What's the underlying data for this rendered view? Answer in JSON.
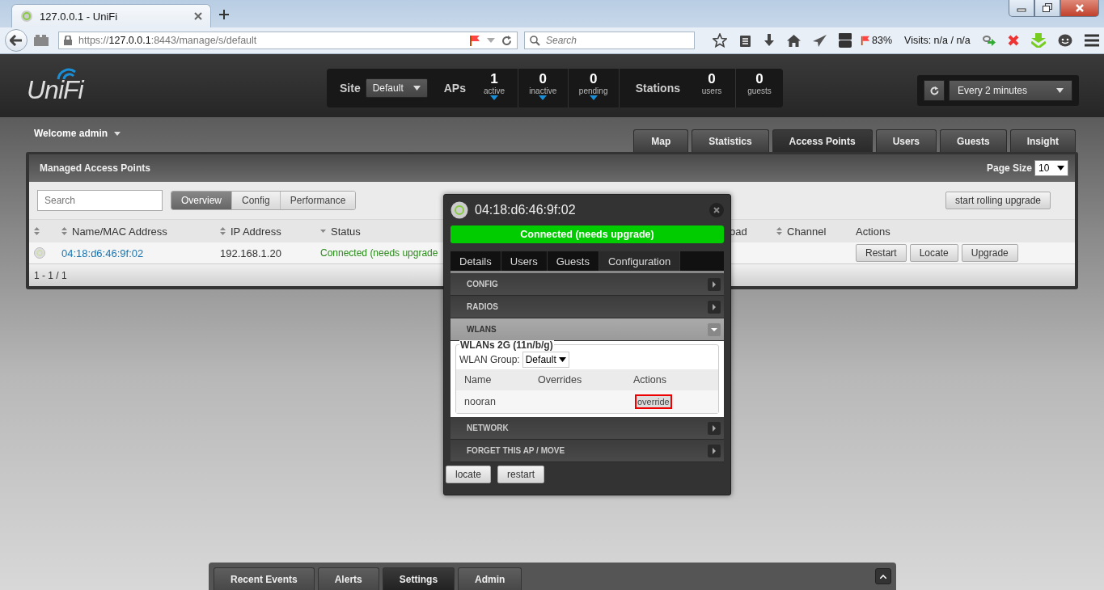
{
  "browser": {
    "tab_title": "127.0.0.1 - UniFi",
    "url_scheme": "https://",
    "url_host": "127.0.0.1",
    "url_path": ":8443/manage/s/default",
    "search_placeholder": "Search",
    "zoom": "83%",
    "visits": "Visits: n/a / n/a"
  },
  "header": {
    "logo": "UniFi",
    "site_label": "Site",
    "site_value": "Default",
    "aps_label": "APs",
    "ap_stats": [
      {
        "value": "1",
        "label": "active",
        "caret": true
      },
      {
        "value": "0",
        "label": "inactive",
        "caret": true
      },
      {
        "value": "0",
        "label": "pending",
        "caret": true
      }
    ],
    "stations_label": "Stations",
    "station_stats": [
      {
        "value": "0",
        "label": "users"
      },
      {
        "value": "0",
        "label": "guests"
      }
    ],
    "refresh": "Every 2 minutes"
  },
  "user_menu": "Welcome admin",
  "nav_tabs": [
    {
      "label": "Map",
      "selected": false
    },
    {
      "label": "Statistics",
      "selected": false
    },
    {
      "label": "Access Points",
      "selected": true
    },
    {
      "label": "Users",
      "selected": false
    },
    {
      "label": "Guests",
      "selected": false
    },
    {
      "label": "Insight",
      "selected": false
    }
  ],
  "panel": {
    "title": "Managed Access Points",
    "page_size_label": "Page Size",
    "page_size": "10",
    "search_placeholder": "Search",
    "view_tabs": [
      {
        "label": "Overview",
        "selected": true
      },
      {
        "label": "Config",
        "selected": false
      },
      {
        "label": "Performance",
        "selected": false
      }
    ],
    "rolling_upgrade": "start rolling upgrade",
    "columns": [
      {
        "kind": "sortable"
      },
      {
        "label": "Name/MAC Address",
        "kind": "sortable"
      },
      {
        "label": "IP Address",
        "kind": "sortable"
      },
      {
        "label": "Status",
        "kind": "sorted"
      },
      {
        "label": "oad",
        "kind": "plain"
      },
      {
        "label": "Channel",
        "kind": "sortable"
      },
      {
        "label": "Actions",
        "kind": "plain"
      }
    ],
    "rows": [
      {
        "name": "04:18:d6:46:9f:02",
        "ip": "192.168.1.20",
        "status": "Connected (needs upgrade",
        "actions": [
          "Restart",
          "Locate",
          "Upgrade"
        ]
      }
    ],
    "footer": "1 - 1 / 1"
  },
  "popup": {
    "title": "04:18:d6:46:9f:02",
    "status": "Connected (needs upgrade)",
    "tabs": [
      {
        "label": "Details",
        "selected": false
      },
      {
        "label": "Users",
        "selected": false
      },
      {
        "label": "Guests",
        "selected": false
      },
      {
        "label": "Configuration",
        "selected": true
      }
    ],
    "sections": [
      {
        "label": "CONFIG",
        "expanded": false
      },
      {
        "label": "RADIOS",
        "expanded": false
      },
      {
        "label": "WLANS",
        "expanded": true
      },
      {
        "label": "NETWORK",
        "expanded": false
      },
      {
        "label": "FORGET THIS AP / MOVE",
        "expanded": false
      }
    ],
    "wlans": {
      "legend": "WLANs 2G (11n/b/g)",
      "group_label": "WLAN Group:",
      "group_value": "Default",
      "columns": [
        "Name",
        "Overrides",
        "Actions"
      ],
      "rows": [
        {
          "name": "nooran",
          "action": "override",
          "highlighted": true
        }
      ]
    },
    "buttons": [
      "locate",
      "restart"
    ]
  },
  "bottom_tabs": [
    {
      "label": "Recent Events",
      "selected": false
    },
    {
      "label": "Alerts",
      "selected": false
    },
    {
      "label": "Settings",
      "selected": true
    },
    {
      "label": "Admin",
      "selected": false
    }
  ]
}
